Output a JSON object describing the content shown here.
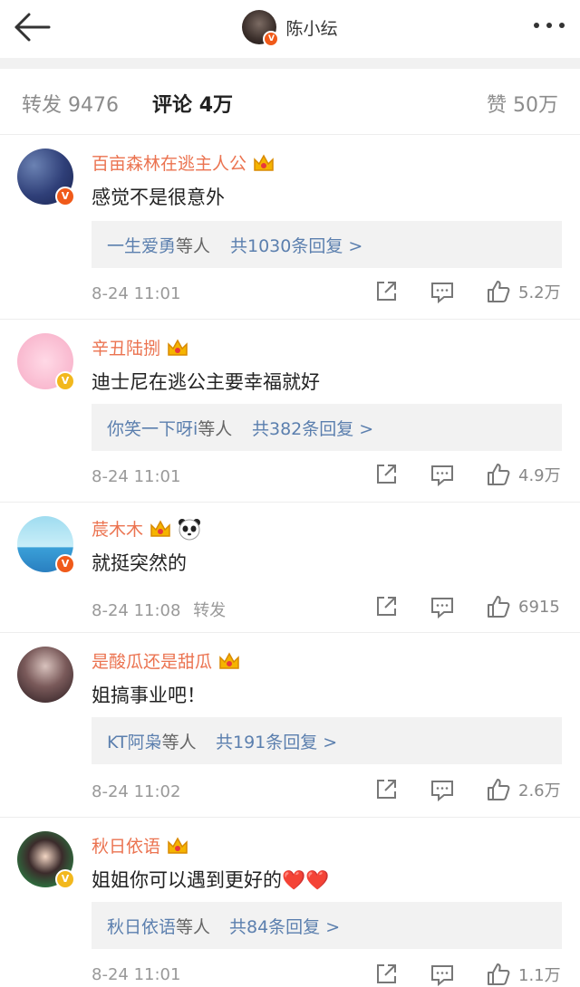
{
  "header": {
    "title": "陈小纭",
    "back_icon": "back-arrow-icon",
    "more_icon": "more-dots-icon"
  },
  "tabs": [
    {
      "label": "转发",
      "count": "9476"
    },
    {
      "label": "评论",
      "count": "4万"
    },
    {
      "label": "赞",
      "count": "50万"
    }
  ],
  "comments": [
    {
      "name": "百亩森林在逃主人公",
      "text": "感觉不是很意外",
      "reply": {
        "names": "一生爱勇",
        "who": "等人",
        "count": "共1030条回复 >"
      },
      "time": "8-24 11:01",
      "extra": "",
      "likes": "5.2万"
    },
    {
      "name": "辛丑陆捌",
      "text": "迪士尼在逃公主要幸福就好",
      "reply": {
        "names": "你笑一下呀i",
        "who": "等人",
        "count": "共382条回复 >"
      },
      "time": "8-24 11:01",
      "extra": "",
      "likes": "4.9万"
    },
    {
      "name": "莀木木",
      "text": "就挺突然的",
      "reply": null,
      "time": "8-24 11:08",
      "extra": "转发",
      "likes": "6915"
    },
    {
      "name": "是酸瓜还是甜瓜",
      "text": "姐搞事业吧！",
      "reply": {
        "names": "KT阿枭",
        "who": "等人",
        "count": "共191条回复 >"
      },
      "time": "8-24 11:02",
      "extra": "",
      "likes": "2.6万"
    },
    {
      "name": "秋日依语",
      "text": "姐姐你可以遇到更好的❤️❤️",
      "reply": {
        "names": "秋日依语",
        "who": "等人",
        "count": "共84条回复 >"
      },
      "time": "8-24 11:01",
      "extra": "",
      "likes": "1.1万"
    }
  ],
  "avatar_badge": "V",
  "colors": {
    "username": "#eb7350",
    "link": "#5b7fae",
    "badge_red": "#f05a1a",
    "badge_gold": "#f2b81d"
  }
}
